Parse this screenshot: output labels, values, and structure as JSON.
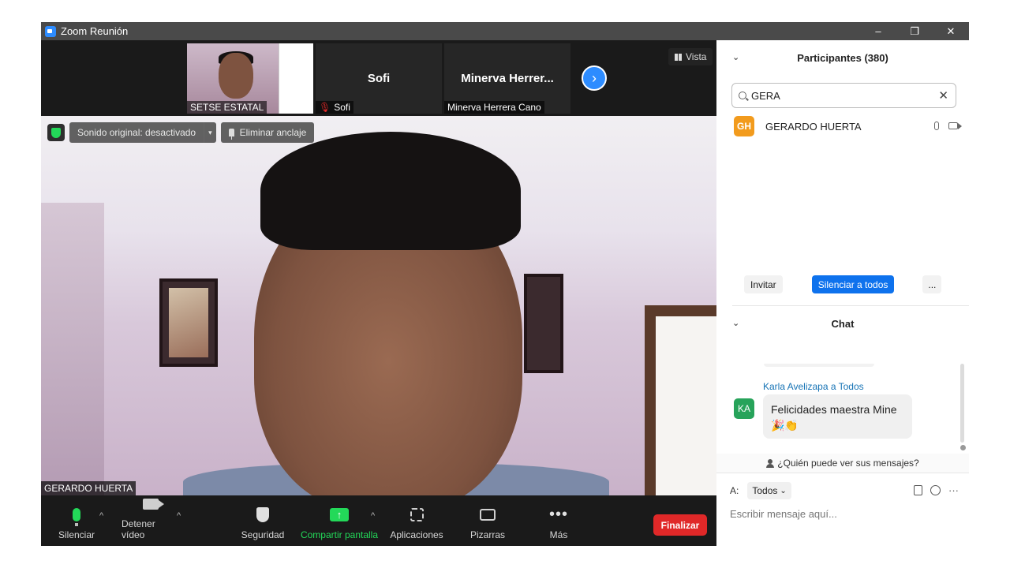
{
  "window": {
    "title": "Zoom Reunión",
    "controls": [
      "–",
      "❐",
      "✕"
    ]
  },
  "thumbnails": [
    {
      "name": "SETSE ESTATAL",
      "center_name": ""
    },
    {
      "name": "Sofi",
      "center_name": "Sofi",
      "muted": true
    },
    {
      "name": "Minerva Herrera Cano",
      "center_name": "Minerva  Herrer..."
    }
  ],
  "next_arrow": "›",
  "vista_label": "Vista",
  "main_video": {
    "speaker_name": "GERARDO HUERTA",
    "original_sound": "Sonido original: desactivado",
    "caret": "▾",
    "unpin": "Eliminar anclaje"
  },
  "toolbar": {
    "mute": "Silenciar",
    "stop_video": "Detener vídeo",
    "caret": "^",
    "security": "Seguridad",
    "share": "Compartir pantalla",
    "share_arrow": "↑",
    "apps": "Aplicaciones",
    "whiteboards": "Pizarras",
    "more": "Más",
    "more_dots": "•••",
    "end": "Finalizar"
  },
  "participants": {
    "header": "Participantes (380)",
    "chevron": "⌄",
    "search_value": "GERA",
    "clear": "✕",
    "list": [
      {
        "initials": "GH",
        "name": "GERARDO HUERTA",
        "avatar_color": "#f29b1d"
      }
    ],
    "invite": "Invitar",
    "mute_all": "Silenciar a todos",
    "more": "..."
  },
  "chat": {
    "header": "Chat",
    "chevron": "⌄",
    "messages": [
      {
        "sender": "Karla Avelizapa a Todos",
        "initials": "KA",
        "text": "Felicidades maestra Mine",
        "emoji": "🎉👏",
        "avatar_color": "#27a35a"
      }
    ],
    "who_can_see": "¿Quién puede ver sus mensajes?",
    "to_label": "A:",
    "to_value": "Todos",
    "to_caret": "⌄",
    "more_icon": "···",
    "input_placeholder": "Escribir mensaje aquí..."
  },
  "colors": {
    "zoom_blue": "#2d8cff",
    "accent_green": "#23d959",
    "end_red": "#e02828",
    "primary_button": "#0e72ed"
  }
}
